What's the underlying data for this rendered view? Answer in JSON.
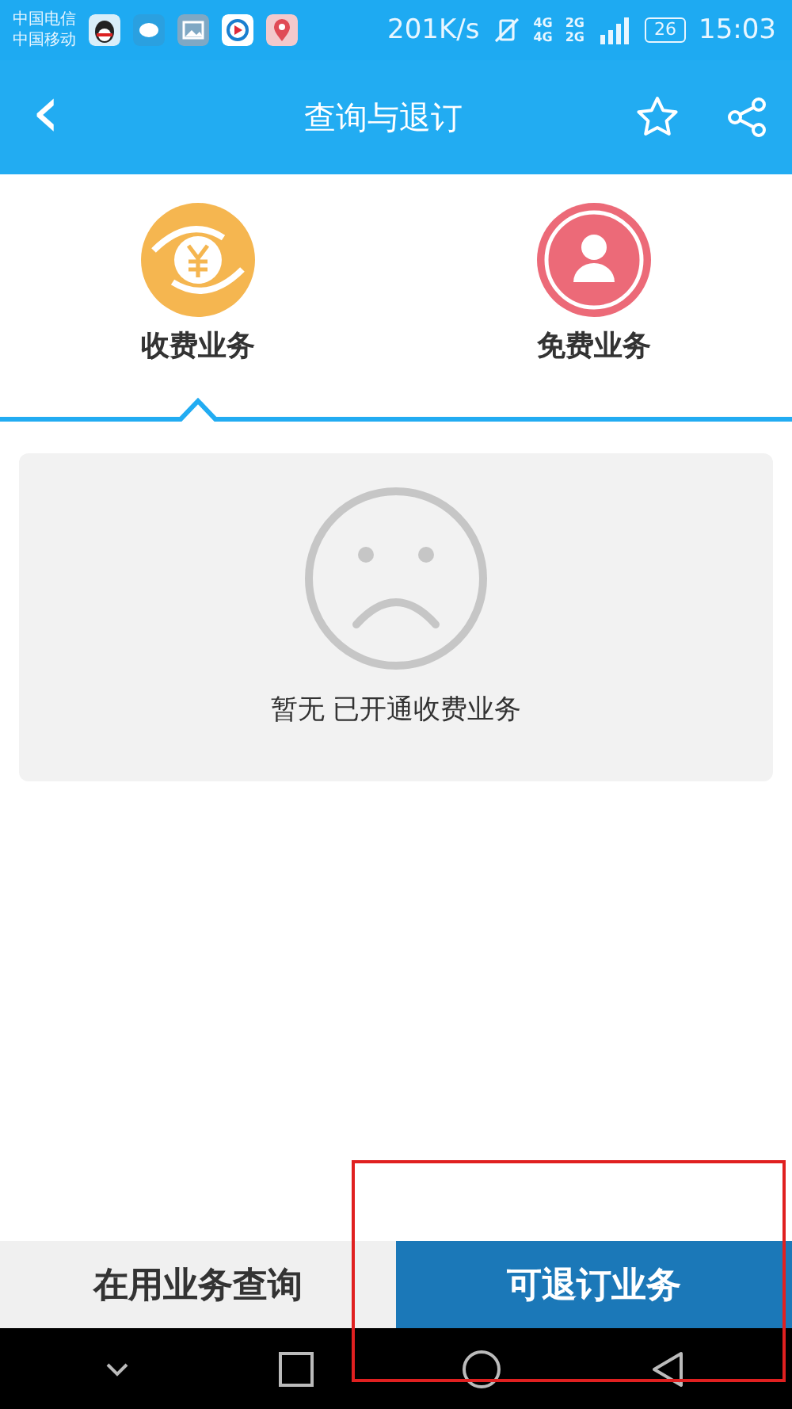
{
  "status_bar": {
    "carriers": [
      "中国电信",
      "中国移动"
    ],
    "speed": "201K/s",
    "network_labels": [
      "4G",
      "4G",
      "2G",
      "2G"
    ],
    "battery": "26",
    "time": "15:03"
  },
  "header": {
    "back": "‹",
    "title": "查询与退订"
  },
  "tabs": [
    {
      "label": "收费业务",
      "kind": "yuan",
      "selected": true
    },
    {
      "label": "免费业务",
      "kind": "person",
      "selected": false
    }
  ],
  "empty_state": {
    "message": "暂无 已开通收费业务"
  },
  "bottom_buttons": [
    {
      "label": "在用业务查询",
      "selected": false
    },
    {
      "label": "可退订业务",
      "selected": true
    }
  ],
  "annotation_frame": true
}
